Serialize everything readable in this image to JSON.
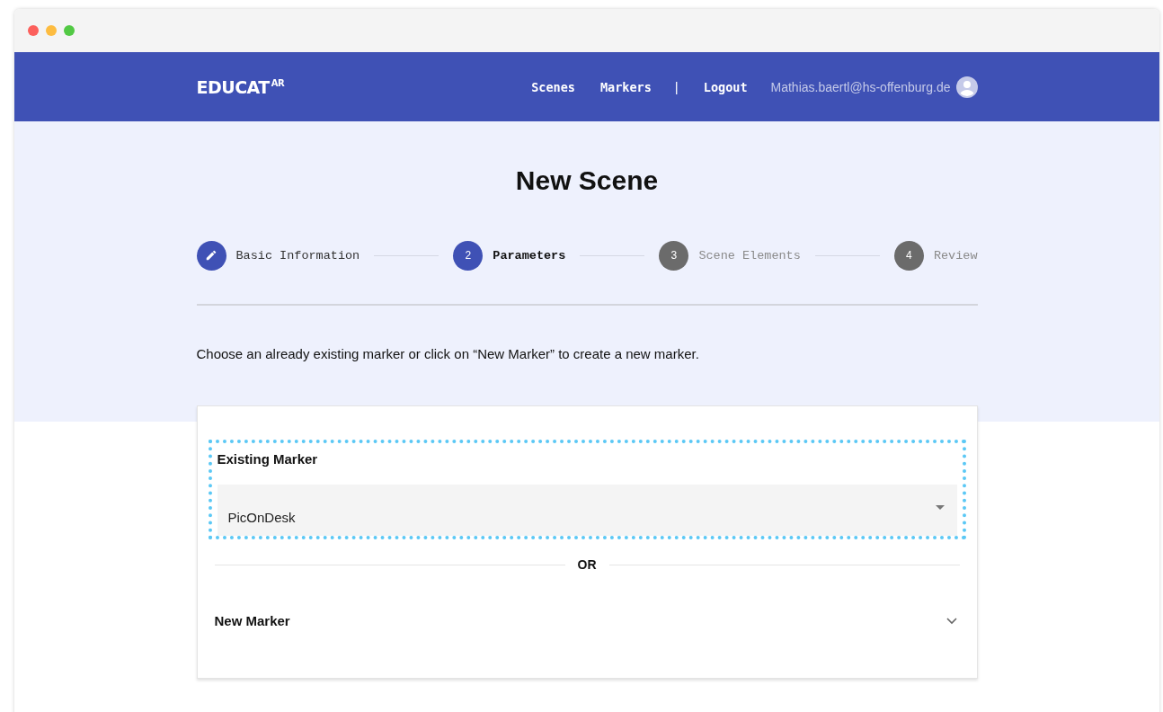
{
  "header": {
    "logo": "EDUCAT",
    "logo_sup": "AR",
    "nav": [
      "Scenes",
      "Markers"
    ],
    "separator": "|",
    "logout": "Logout",
    "user": "Mathias.baertl@hs-offenburg.de"
  },
  "title": "New Scene",
  "steps": [
    {
      "label": "Basic Information",
      "completed": true,
      "selected": false
    },
    {
      "number": "2",
      "label": "Parameters",
      "completed": false,
      "selected": true
    },
    {
      "number": "3",
      "label": "Scene Elements",
      "completed": false,
      "selected": false
    },
    {
      "number": "4",
      "label": "Review",
      "completed": false,
      "selected": false
    }
  ],
  "instruction": "Choose an already existing marker or click on “New Marker” to create a new marker.",
  "existing_marker": {
    "label": "Existing Marker",
    "value": "PicOnDesk",
    "focused": true
  },
  "divider": "OR",
  "new_marker": {
    "label": "New Marker",
    "expanded": false
  }
}
